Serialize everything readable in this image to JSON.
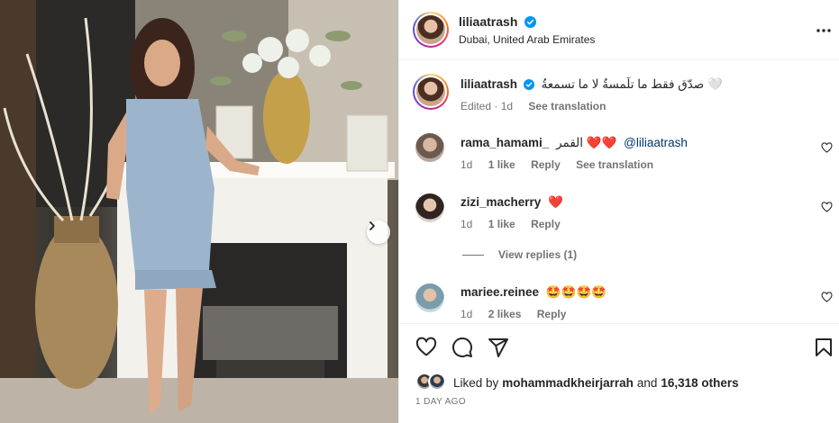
{
  "post": {
    "author": "liliaatrash",
    "location": "Dubai, United Arab Emirates"
  },
  "caption": {
    "username": "liliaatrash",
    "text": "صدّق فقط ما تلَمسةُ لا ما تسمعةُ 🤍",
    "edited": "Edited",
    "age": "1d",
    "see_translation": "See translation"
  },
  "comments": [
    {
      "username": "rama_hamami_",
      "text": "القمر ❤️❤️",
      "mention": "@liliaatrash",
      "age": "1d",
      "likes": "1 like",
      "reply": "Reply",
      "see_translation": "See translation"
    },
    {
      "username": "zizi_macherry",
      "text": "❤️",
      "age": "1d",
      "likes": "1 like",
      "reply": "Reply"
    },
    {
      "username": "mariee.reinee",
      "text": "🤩🤩🤩🤩",
      "age": "1d",
      "likes": "2 likes",
      "reply": "Reply"
    }
  ],
  "view_replies": "View replies (1)",
  "likes": {
    "prefix": "Liked by",
    "user": "mohammadkheirjarrah",
    "and": "and",
    "others": "16,318 others"
  },
  "timestamp": "1 DAY AGO",
  "icons": {
    "like": "heart-icon",
    "comment": "comment-icon",
    "share": "share-icon",
    "save": "bookmark-icon",
    "more": "more-icon",
    "next": "chevron-right-icon",
    "verified": "verified-badge-icon"
  },
  "colors": {
    "verified": "#0095f6",
    "mention": "#00376b",
    "secondary_text": "#737373",
    "heart": "#ed4956"
  }
}
